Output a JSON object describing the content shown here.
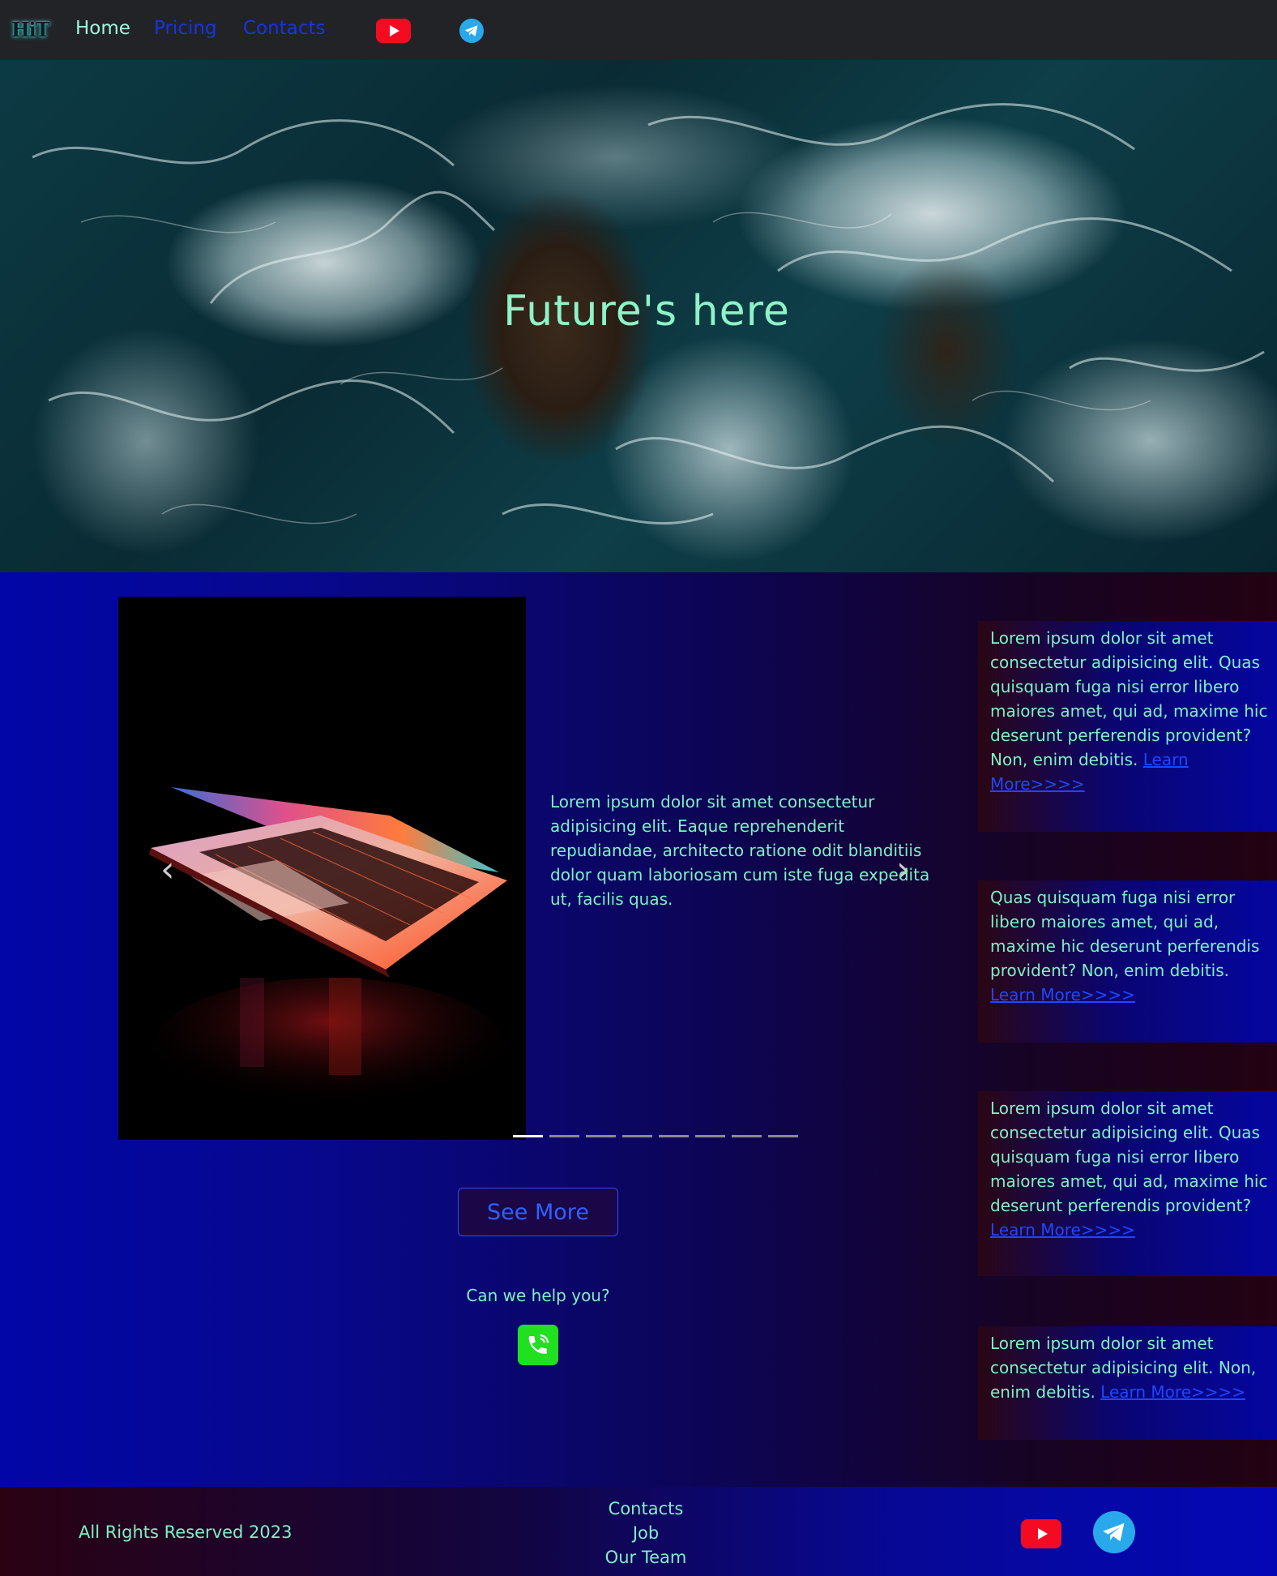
{
  "nav": {
    "logo": "HiT",
    "links": [
      "Home",
      "Pricing",
      "Contacts"
    ],
    "social_icons": [
      "youtube-icon",
      "telegram-icon"
    ]
  },
  "hero": {
    "title": "Future's here"
  },
  "carousel": {
    "prev_icon": "‹",
    "next_icon": "›",
    "slide_count": 8,
    "active_slide": 1
  },
  "main": {
    "text": "Lorem ipsum dolor sit amet consectetur adipisicing elit. Eaque reprehenderit repudiandae, architecto ratione odit blanditiis dolor quam laboriosam cum iste fuga expedita ut, facilis quas.",
    "see_more": "See More",
    "help": "Can we help you?"
  },
  "cards": [
    {
      "text": "Lorem ipsum dolor sit amet consectetur adipisicing elit. Quas quisquam fuga nisi error libero maiores amet, qui ad, maxime hic deserunt perferendis provident? Non, enim debitis. ",
      "link": "Learn More>>>>"
    },
    {
      "text": "Quas quisquam fuga nisi error libero maiores amet, qui ad, maxime hic deserunt perferendis provident? Non, enim debitis. ",
      "link": "Learn More>>>>"
    },
    {
      "text": "Lorem ipsum dolor sit amet consectetur adipisicing elit. Quas quisquam fuga nisi error libero maiores amet, qui ad, maxime hic deserunt perferendis provident? ",
      "link": "Learn More>>>>"
    },
    {
      "text": "Lorem ipsum dolor sit amet consectetur adipisicing elit. Non, enim debitis. ",
      "link": "Learn More>>>>"
    }
  ],
  "footer": {
    "copyright": "All Rights Reserved 2023",
    "links": [
      "Contacts",
      "Job",
      "Our Team"
    ]
  },
  "colors": {
    "accent_text": "#7ff0c5",
    "link_blue": "#1733e6",
    "youtube_red": "#f40b22",
    "telegram_blue": "#29a9eb",
    "phone_green": "#20e020"
  }
}
